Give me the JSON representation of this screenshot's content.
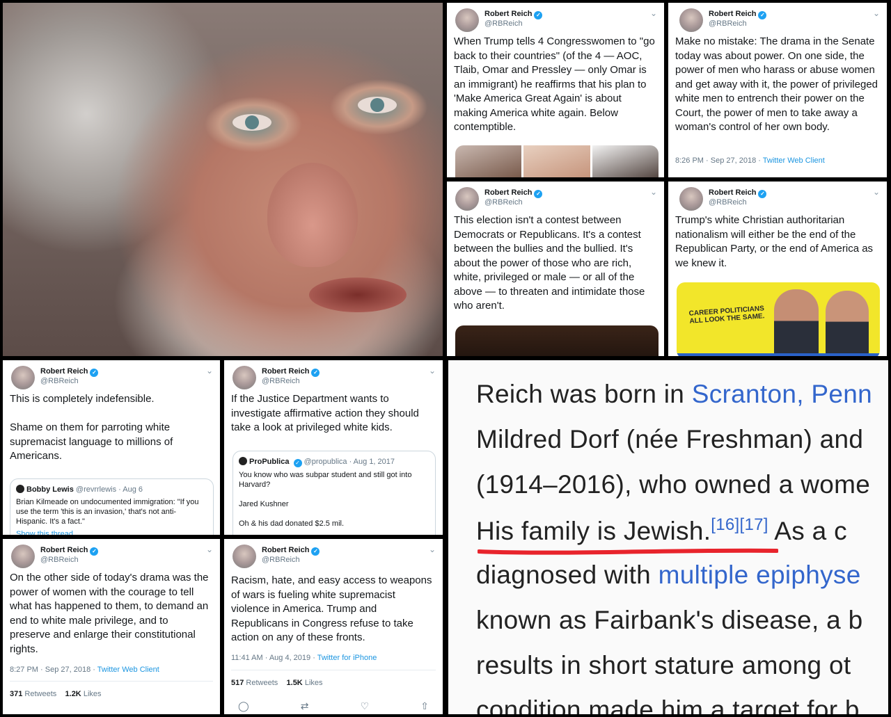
{
  "tweets": {
    "t1": {
      "name": "Robert Reich",
      "handle": "@RBReich",
      "text": "When Trump tells 4 Congresswomen to \"go back to their countries\" (of the 4 — AOC, Tlaib, Omar and Pressley — only Omar is an immigrant) he reaffirms that his plan to 'Make America Great Again' is about making America white again. Below contemptible."
    },
    "t2": {
      "name": "Robert Reich",
      "handle": "@RBReich",
      "text": "Make no mistake: The drama in the Senate today was about power. On one side, the power of men who harass or abuse women and get away with it, the power of privileged white men to entrench their power on the Court, the power of men to take away a woman's control of her own body.",
      "time": "8:26 PM · Sep 27, 2018",
      "client": "Twitter Web Client"
    },
    "t3": {
      "name": "Robert Reich",
      "handle": "@RBReich",
      "text": "This election isn't a contest between Democrats or Republicans. It's a contest between the bullies and the bullied. It's about the power of those who are rich, white, privileged or male — or all of the above — to threaten and intimidate those who aren't."
    },
    "t4": {
      "name": "Robert Reich",
      "handle": "@RBReich",
      "text": "Trump's white Christian authoritarian nationalism will either be the end of the Republican Party, or the end of America as we knew it.",
      "image_text": "CAREER POLITICIANS\nALL LOOK THE SAME."
    },
    "t5": {
      "name": "Robert Reich",
      "handle": "@RBReich",
      "text": "This is completely indefensible.\n\nShame on them for parroting white supremacist language to millions of Americans.",
      "quote": {
        "name": "Bobby Lewis",
        "handle": "@revrrlewis · Aug 6",
        "body": "Brian Kilmeade on undocumented immigration: \"If you use the term 'this is an invasion,' that's not anti-Hispanic. It's a fact.\"",
        "link": "Show this thread"
      }
    },
    "t6": {
      "name": "Robert Reich",
      "handle": "@RBReich",
      "text": "If the Justice Department wants to investigate affirmative action they should take a look at privileged white kids.",
      "quote": {
        "name": "ProPublica",
        "handle": "@propublica · Aug 1, 2017",
        "body": "You know who was subpar student and still got into Harvard?\n\nJared Kushner\n\nOh & his dad donated $2.5 mil."
      }
    },
    "t7": {
      "name": "Robert Reich",
      "handle": "@RBReich",
      "text": "On the other side of today's drama was the power of women with the courage to tell what has happened to them, to demand an end to white male privilege, and to preserve and enlarge their constitutional rights.",
      "time": "8:27 PM · Sep 27, 2018",
      "client": "Twitter Web Client",
      "retweets": "371",
      "retweets_label": "Retweets",
      "likes": "1.2K",
      "likes_label": "Likes"
    },
    "t8": {
      "name": "Robert Reich",
      "handle": "@RBReich",
      "text": "Racism, hate, and easy access to weapons of wars is fueling white supremacist violence in America. Trump and Republicans in Congress refuse to take action on any of these fronts.",
      "time": "11:41 AM · Aug 4, 2019",
      "client": "Twitter for iPhone",
      "retweets": "517",
      "retweets_label": "Retweets",
      "likes": "1.5K",
      "likes_label": "Likes"
    }
  },
  "wiki": {
    "l1_text": "Reich was born in ",
    "l1_link": "Scranton, Penn",
    "l2_text": "Mildred Dorf (née Freshman) and",
    "l3_text": "(1914–2016), who owned a wome",
    "l4_text": "His family is Jewish.",
    "l4_refs": "[16][17]",
    "l4_tail": " As a c",
    "l5_text": "diagnosed with ",
    "l5_link": "multiple epiphyse",
    "l6_text": "known as Fairbank's disease, a b",
    "l7_text": "results in short stature among ot",
    "l8_text": "condition made him a target for b"
  },
  "colors": {
    "twitter_blue": "#1da1f2",
    "link_blue": "#3366cc",
    "underline_red": "#e8242c"
  }
}
